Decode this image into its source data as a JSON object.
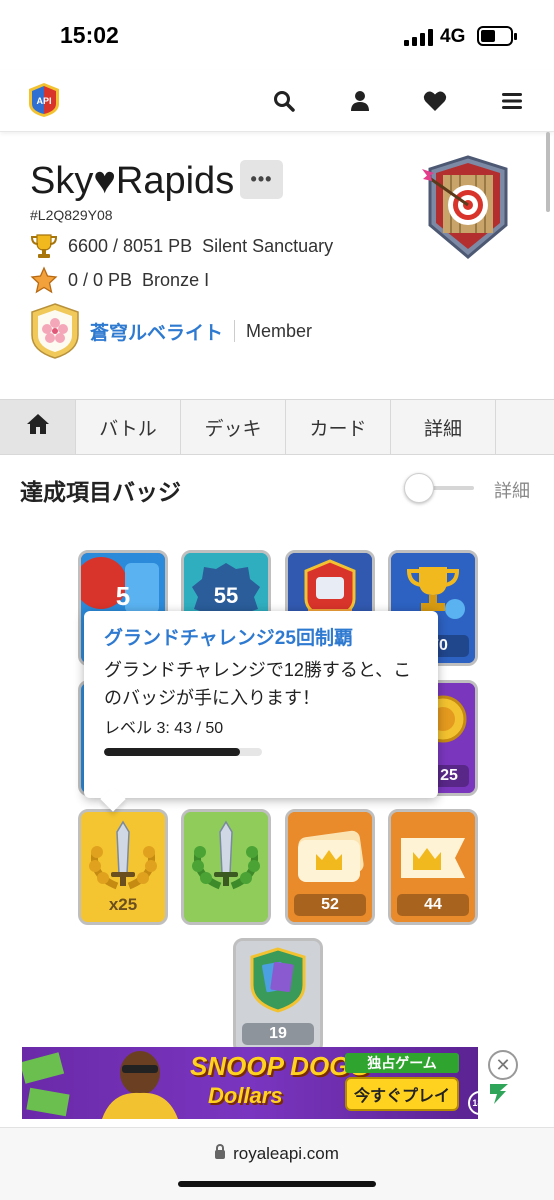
{
  "status_bar": {
    "time": "15:02",
    "network": "4G"
  },
  "player": {
    "name": "Sky♥Rapids",
    "more_label": "•••",
    "tag": "#L2Q829Y08",
    "trophies": "6600 / 8051 PB",
    "arena": "Silent Sanctuary",
    "path_of_legends": "0 / 0 PB",
    "league": "Bronze I",
    "clan_name": "蒼穹ルベライト",
    "clan_role": "Member"
  },
  "tabs": [
    "バトル",
    "デッキ",
    "カード",
    "詳細"
  ],
  "section": {
    "title": "達成項目バッジ",
    "toggle_label": "詳細"
  },
  "tooltip": {
    "title": "グランドチャレンジ25回制覇",
    "description": "グランドチャレンジで12勝すると、このバッジが手に入ります！",
    "level": "レベル 3: 43 / 50",
    "progress": 0.86
  },
  "badges": {
    "row1": [
      "5",
      "55",
      "",
      "70"
    ],
    "row2_right": "25",
    "row3": [
      "x25",
      "",
      "52",
      "44"
    ],
    "row4": [
      "19"
    ]
  },
  "ad": {
    "title_line1": "SNOOP DOGG",
    "title_line2": "Dollars",
    "tag": "独占ゲーム",
    "cta": "今すぐプレイ",
    "age": "18+"
  },
  "browser": {
    "url": "royaleapi.com"
  },
  "colors": {
    "link": "#2f7ad1",
    "ad_bg": "#6a2aa8",
    "accent_gold": "#f2c230"
  }
}
